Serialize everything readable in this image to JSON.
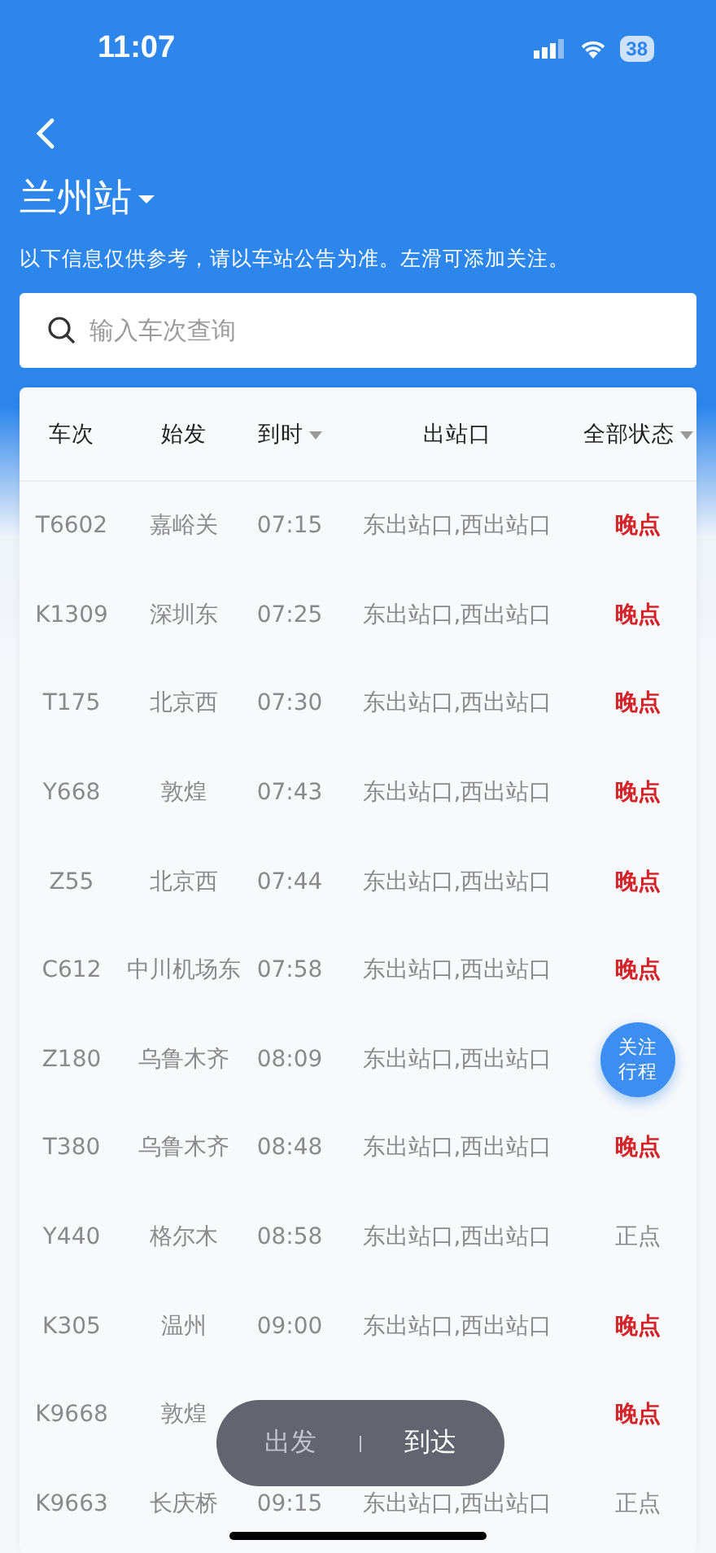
{
  "status_bar": {
    "time": "11:07",
    "battery": "38"
  },
  "header": {
    "station": "兰州站",
    "notice": "以下信息仅供参考，请以车站公告为准。左滑可添加关注。"
  },
  "search": {
    "placeholder": "输入车次查询"
  },
  "table": {
    "columns": [
      "车次",
      "始发",
      "到时",
      "出站口",
      "全部状态"
    ],
    "rows": [
      {
        "train": "T6602",
        "origin": "嘉峪关",
        "time": "07:15",
        "exit": "东出站口,西出站口",
        "kind": "late",
        "status": "晚点"
      },
      {
        "train": "K1309",
        "origin": "深圳东",
        "time": "07:25",
        "exit": "东出站口,西出站口",
        "kind": "late",
        "status": "晚点"
      },
      {
        "train": "T175",
        "origin": "北京西",
        "time": "07:30",
        "exit": "东出站口,西出站口",
        "kind": "late",
        "status": "晚点"
      },
      {
        "train": "Y668",
        "origin": "敦煌",
        "time": "07:43",
        "exit": "东出站口,西出站口",
        "kind": "late",
        "status": "晚点"
      },
      {
        "train": "Z55",
        "origin": "北京西",
        "time": "07:44",
        "exit": "东出站口,西出站口",
        "kind": "late",
        "status": "晚点"
      },
      {
        "train": "C612",
        "origin": "中川机场东",
        "time": "07:58",
        "exit": "东出站口,西出站口",
        "kind": "late",
        "status": "晚点"
      },
      {
        "train": "Z180",
        "origin": "乌鲁木齐",
        "time": "08:09",
        "exit": "东出站口,西出站口",
        "kind": "follow",
        "status": "关注行程"
      },
      {
        "train": "T380",
        "origin": "乌鲁木齐",
        "time": "08:48",
        "exit": "东出站口,西出站口",
        "kind": "late",
        "status": "晚点"
      },
      {
        "train": "Y440",
        "origin": "格尔木",
        "time": "08:58",
        "exit": "东出站口,西出站口",
        "kind": "ontime",
        "status": "正点"
      },
      {
        "train": "K305",
        "origin": "温州",
        "time": "09:00",
        "exit": "东出站口,西出站口",
        "kind": "late",
        "status": "晚点"
      },
      {
        "train": "K9668",
        "origin": "敦煌",
        "kind": "late",
        "status": "晚点"
      },
      {
        "train": "K9663",
        "origin": "长庆桥",
        "time": "09:15",
        "exit": "东出站口,西出站口",
        "kind": "ontime",
        "status": "正点"
      }
    ]
  },
  "toggle": [
    {
      "label": "出发",
      "selected": false
    },
    {
      "label": "到达",
      "selected": true
    }
  ]
}
